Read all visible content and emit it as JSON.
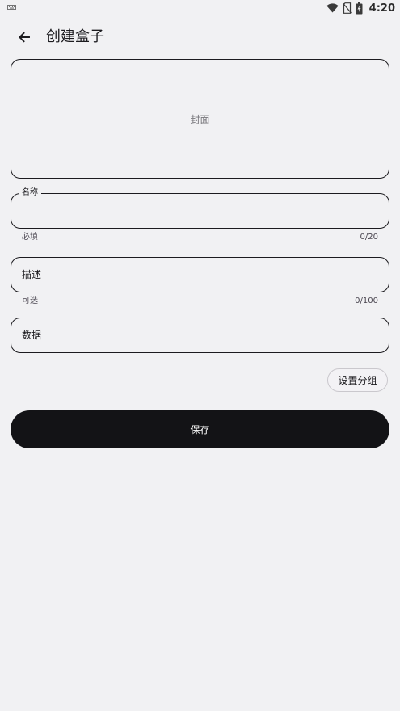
{
  "status_bar": {
    "time": "4:20",
    "icons": [
      "keyboard-icon",
      "wifi-icon",
      "no-sim-icon",
      "battery-charging-icon"
    ]
  },
  "app_bar": {
    "back_icon": "arrow-back-icon",
    "title": "创建盒子"
  },
  "cover": {
    "label": "封面"
  },
  "fields": {
    "name": {
      "label": "名称",
      "value": "",
      "helper": "必填",
      "counter": "0/20"
    },
    "description": {
      "placeholder": "描述",
      "value": "",
      "helper": "可选",
      "counter": "0/100"
    },
    "data": {
      "placeholder": "数据",
      "value": ""
    }
  },
  "actions": {
    "set_group_label": "设置分组",
    "save_label": "保存"
  },
  "colors": {
    "background": "#f1f1f3",
    "primary_button": "#131316",
    "outline": "#1c1b1f"
  }
}
